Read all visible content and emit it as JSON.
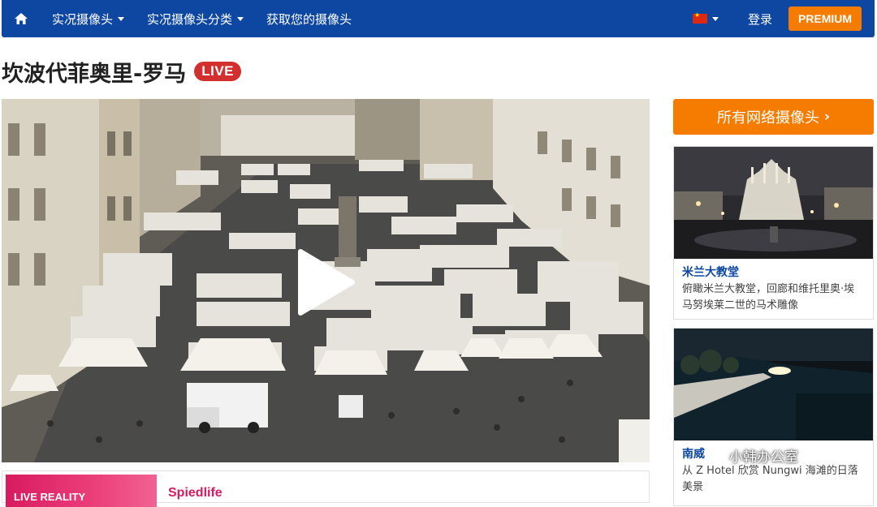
{
  "navbar": {
    "home_icon": "home-icon",
    "items": [
      {
        "label": "实况摄像头",
        "has_dropdown": true
      },
      {
        "label": "实况摄像头分类",
        "has_dropdown": true
      },
      {
        "label": "获取您的摄像头",
        "has_dropdown": false
      }
    ],
    "language_flag": "china-flag-icon",
    "login_label": "登录",
    "premium_label": "PREMIUM"
  },
  "page": {
    "title": "坎波代菲奥里-罗马",
    "live_badge": "LIVE"
  },
  "player": {
    "play_icon": "play-icon"
  },
  "related_card": {
    "thumb_text": "LIVE REALITY",
    "title": "Spiedlife"
  },
  "sidebar": {
    "all_cams_label": "所有网络摄像头",
    "cards": [
      {
        "title": "米兰大教堂",
        "description": "俯瞰米兰大教堂，回廊和维托里奥·埃马努埃莱二世的马术雕像"
      },
      {
        "title": "南威",
        "description": "从 Z Hotel 欣赏 Nungwi 海滩的日落美景"
      }
    ]
  },
  "watermark": {
    "text": "小韩办公室"
  },
  "colors": {
    "nav_blue": "#0d47a1",
    "accent_orange": "#f57c00",
    "live_red": "#d32f2f",
    "link_blue": "#0d47a1"
  }
}
